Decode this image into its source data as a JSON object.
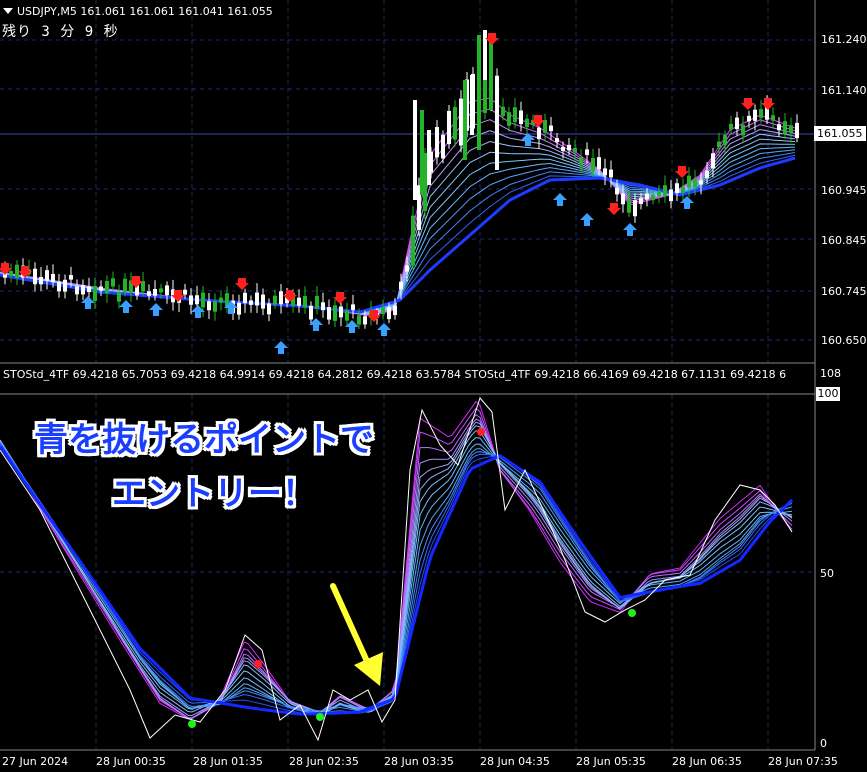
{
  "chart": {
    "symbol_line": "USDJPY,M5  161.061 161.061 161.041 161.055",
    "countdown": "残り 3 分 9 秒",
    "current_price": "161.055",
    "price_axis": [
      "161.240",
      "161.140",
      "161.055",
      "160.945",
      "160.845",
      "160.745",
      "160.650"
    ],
    "time_axis": [
      "27 Jun 2024",
      "28 Jun 00:35",
      "28 Jun 01:35",
      "28 Jun 02:35",
      "28 Jun 03:35",
      "28 Jun 04:35",
      "28 Jun 05:35",
      "28 Jun 06:35",
      "28 Jun 07:35"
    ]
  },
  "indicator": {
    "label": "STOStd_4TF 69.4218 65.7053 69.4218 64.9914 69.4218 64.2812 69.4218 63.5784  STOStd_4TF 69.4218 66.4169 69.4218 67.1131 69.4218 6",
    "axis_top": "108",
    "axis_100": "100",
    "axis_50": "50",
    "axis_0": "0"
  },
  "annotation": {
    "line1": "青を抜けるポイントで",
    "line2": "エントリー！"
  },
  "colors": {
    "background": "#000000",
    "grid": "#1c2a6e",
    "bull_candle": "#22b52a",
    "bear_candle": "#ffffff",
    "up_arrow": "#3aa0ff",
    "down_arrow": "#ff2020",
    "ma_slow": "#1a1aff",
    "ma_fast": "#ff33ff",
    "arrow_annotation": "#ffff33"
  }
}
